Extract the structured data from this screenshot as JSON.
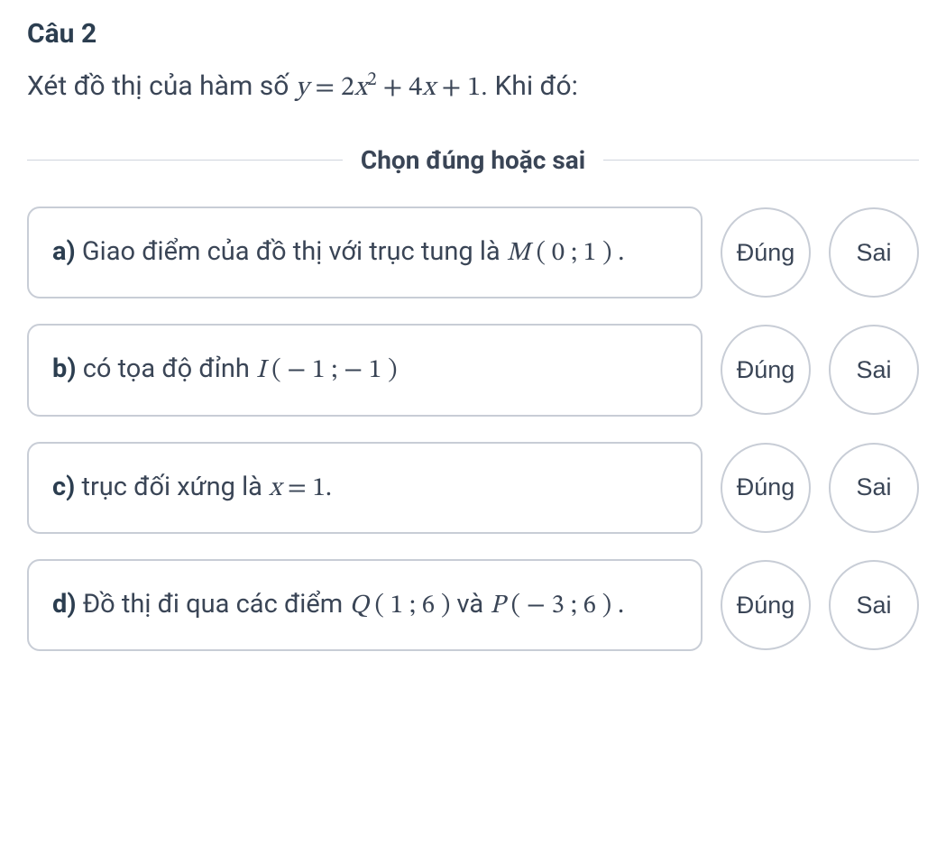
{
  "question": {
    "number": "Câu 2",
    "prefix": "Xét đồ thị của hàm số ",
    "formula_html": "<span class='math-var'>y</span> = 2<span class='math-var'>x</span><span class='math-sup'>2</span> + 4<span class='math-var'>x</span> + 1",
    "suffix": ". Khi đó:"
  },
  "instruction": "Chọn đúng hoặc sai",
  "buttons": {
    "true_label": "Đúng",
    "false_label": "Sai"
  },
  "options": [
    {
      "label": "a)",
      "text_html": " Giao điểm của đồ thị với trục tung là <span class='math-expr'><span class='math-var'>M</span> ( 0 ; 1 ) .</span>"
    },
    {
      "label": "b)",
      "text_html": " có tọa độ đỉnh <span class='math-expr'><span class='math-var'>I</span> ( − 1 ; − 1 )</span>"
    },
    {
      "label": "c)",
      "text_html": " trục đối xứng là <span class='math-expr'><span class='math-var'>x</span> = 1.</span>"
    },
    {
      "label": "d)",
      "text_html": " Đồ thị đi qua các điểm <span class='math-expr'><span class='math-var'>Q</span> ( 1 ; 6 )</span> và <span class='math-expr'><span class='math-var'>P</span> ( − 3 ; 6 ) .</span>"
    }
  ]
}
